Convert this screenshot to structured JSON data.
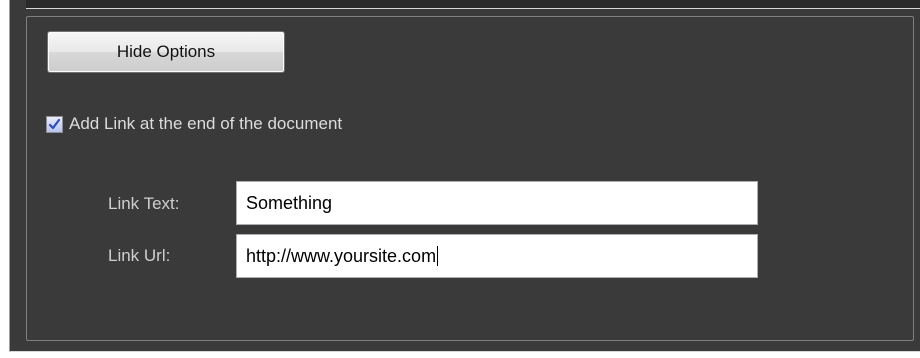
{
  "options": {
    "hide_button_label": "Hide Options",
    "add_link_checkbox": {
      "label": "Add Link at the end of the document",
      "checked": true
    },
    "link_text": {
      "label": "Link Text:",
      "value": "Something"
    },
    "link_url": {
      "label": "Link Url:",
      "value": "http://www.yoursite.com"
    }
  },
  "colors": {
    "panel_background": "#3a3a3a",
    "label_text": "#cfcfcf",
    "checkbox_accent": "#2d4fb2"
  }
}
